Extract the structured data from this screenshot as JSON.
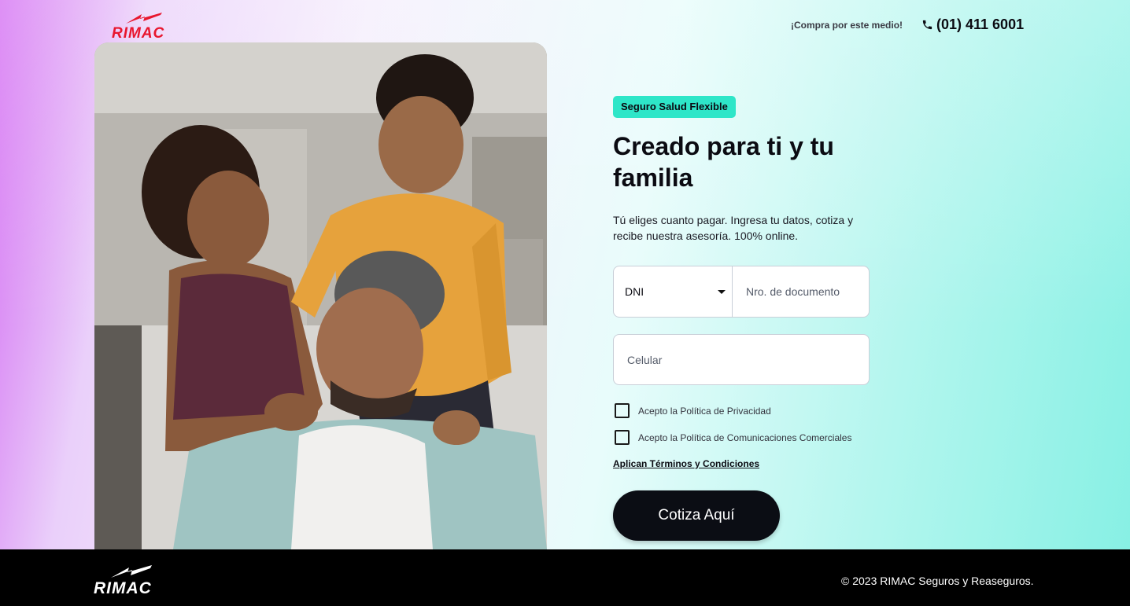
{
  "header": {
    "logo_text": "RIMAC",
    "buy_text": "¡Compra por este medio!",
    "phone": "(01) 411 6001",
    "phone_icon": "phone-icon"
  },
  "hero": {
    "image_alt": "Familia feliz: madre, padre e hijo sonriendo"
  },
  "form": {
    "badge": "Seguro Salud Flexible",
    "headline": "Creado para ti y tu familia",
    "subtitle": "Tú eliges cuanto pagar. Ingresa tu datos, cotiza y recibe nuestra asesoría. 100% online.",
    "doc_type": "DNI",
    "doc_placeholder": "Nro. de documento",
    "phone_placeholder": "Celular",
    "privacy_label": "Acepto la Política de Privacidad",
    "privacy_checked": false,
    "comms_label": "Acepto la Política de Comunicaciones Comerciales",
    "comms_checked": false,
    "terms_link": "Aplican Términos y Condiciones",
    "cta": "Cotiza Aquí"
  },
  "footer": {
    "logo_text": "RIMAC",
    "copyright": "© 2023 RIMAC Seguros y Reaseguros."
  },
  "colors": {
    "brand_red": "#e8162e",
    "badge_bg": "#2ee6c8",
    "cta_bg": "#0b0d14"
  }
}
